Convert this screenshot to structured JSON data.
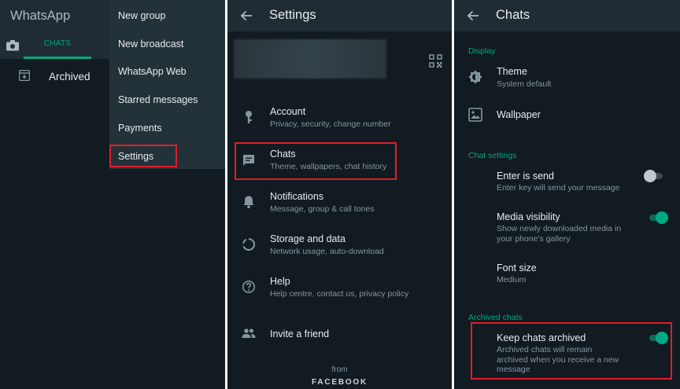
{
  "left_panel": {
    "app_title": "WhatsApp",
    "tab_chats": "CHATS",
    "archived": "Archived",
    "menu": [
      "New group",
      "New broadcast",
      "WhatsApp Web",
      "Starred messages",
      "Payments",
      "Settings"
    ],
    "icons": {
      "camera": "camera-icon",
      "archive": "archive-icon"
    }
  },
  "settings_panel": {
    "title": "Settings",
    "items": [
      {
        "title": "Account",
        "subtitle": "Privacy, security, change number",
        "icon": "key-icon"
      },
      {
        "title": "Chats",
        "subtitle": "Theme, wallpapers, chat history",
        "icon": "chat-icon"
      },
      {
        "title": "Notifications",
        "subtitle": "Message, group & call tones",
        "icon": "bell-icon"
      },
      {
        "title": "Storage and data",
        "subtitle": "Network usage, auto-download",
        "icon": "data-usage-icon"
      },
      {
        "title": "Help",
        "subtitle": "Help centre, contact us, privacy policy",
        "icon": "help-icon"
      },
      {
        "title": "Invite a friend",
        "subtitle": "",
        "icon": "people-icon"
      }
    ],
    "footer_from": "from",
    "footer_brand": "FACEBOOK"
  },
  "chats_panel": {
    "title": "Chats",
    "sections": {
      "display": "Display",
      "chat_settings": "Chat settings",
      "archived": "Archived chats"
    },
    "theme": {
      "title": "Theme",
      "subtitle": "System default"
    },
    "wallpaper": {
      "title": "Wallpaper"
    },
    "enter_is_send": {
      "title": "Enter is send",
      "subtitle": "Enter key will send your message",
      "enabled": false
    },
    "media_visibility": {
      "title": "Media visibility",
      "subtitle": "Show newly downloaded media in your phone's gallery",
      "enabled": true
    },
    "font_size": {
      "title": "Font size",
      "subtitle": "Medium"
    },
    "keep_archived": {
      "title": "Keep chats archived",
      "subtitle": "Archived chats will remain archived when you receive a new message",
      "enabled": true
    }
  },
  "colors": {
    "background": "#111b21",
    "bar": "#202c33",
    "accent": "#00a884",
    "highlight": "#e11d2a"
  }
}
